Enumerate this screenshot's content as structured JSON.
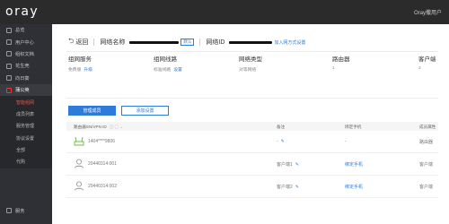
{
  "header": {
    "logo": "oray",
    "user": "Oray撒用户"
  },
  "sidebar": {
    "items": [
      {
        "label": "总览",
        "icon": "home-icon"
      },
      {
        "label": "用户中心",
        "icon": "user-icon"
      },
      {
        "label": "组织文档",
        "icon": "doc-icon"
      },
      {
        "label": "花生壳",
        "icon": "peanut-icon"
      },
      {
        "label": "向日葵",
        "icon": "sunflower-icon"
      },
      {
        "label": "蒲公英",
        "icon": "dandelion-icon"
      }
    ],
    "sub_items": [
      "智能组网",
      "成员列表",
      "服务管理",
      "协议设置",
      "全部",
      "代购"
    ],
    "bottom": {
      "label": "服务",
      "icon": "service-icon"
    }
  },
  "head": {
    "back_label": "返回",
    "network_name_label": "网络名称",
    "network_name_tag": "默认",
    "network_id_label": "网络ID",
    "invite_link": "加入网方式设置"
  },
  "info": [
    {
      "title": "组网服务",
      "value": "免费版",
      "link": "升级"
    },
    {
      "title": "组网线路",
      "value": "标准线路",
      "link": "设置"
    },
    {
      "title": "网络类型",
      "value": "对等网络",
      "link": ""
    },
    {
      "title": "路由器",
      "value": "1",
      "link": ""
    },
    {
      "title": "客户端",
      "value": "2",
      "link": ""
    }
  ],
  "buttons": {
    "primary": "管理成员",
    "secondary": "添加设置"
  },
  "table": {
    "headers": {
      "name": "路由器SN/VPN ID",
      "note": "备注",
      "phone": "绑定手机",
      "owner": "成员属性"
    },
    "rows": [
      {
        "type": "router",
        "name": "1404****9806",
        "note": "-",
        "phone": "-",
        "owner": "路由器"
      },
      {
        "type": "client",
        "name": "20440314:001",
        "note": "客户端1",
        "phone": "绑定手机",
        "owner": "客户端"
      },
      {
        "type": "client",
        "name": "20440314:002",
        "note": "客户端2",
        "phone": "绑定手机",
        "owner": "客户端"
      }
    ]
  },
  "colors": {
    "accent": "#2f7bd9",
    "sidebar": "#2f3035",
    "topbar": "#2b2b2b",
    "active_red": "#e03c31"
  }
}
